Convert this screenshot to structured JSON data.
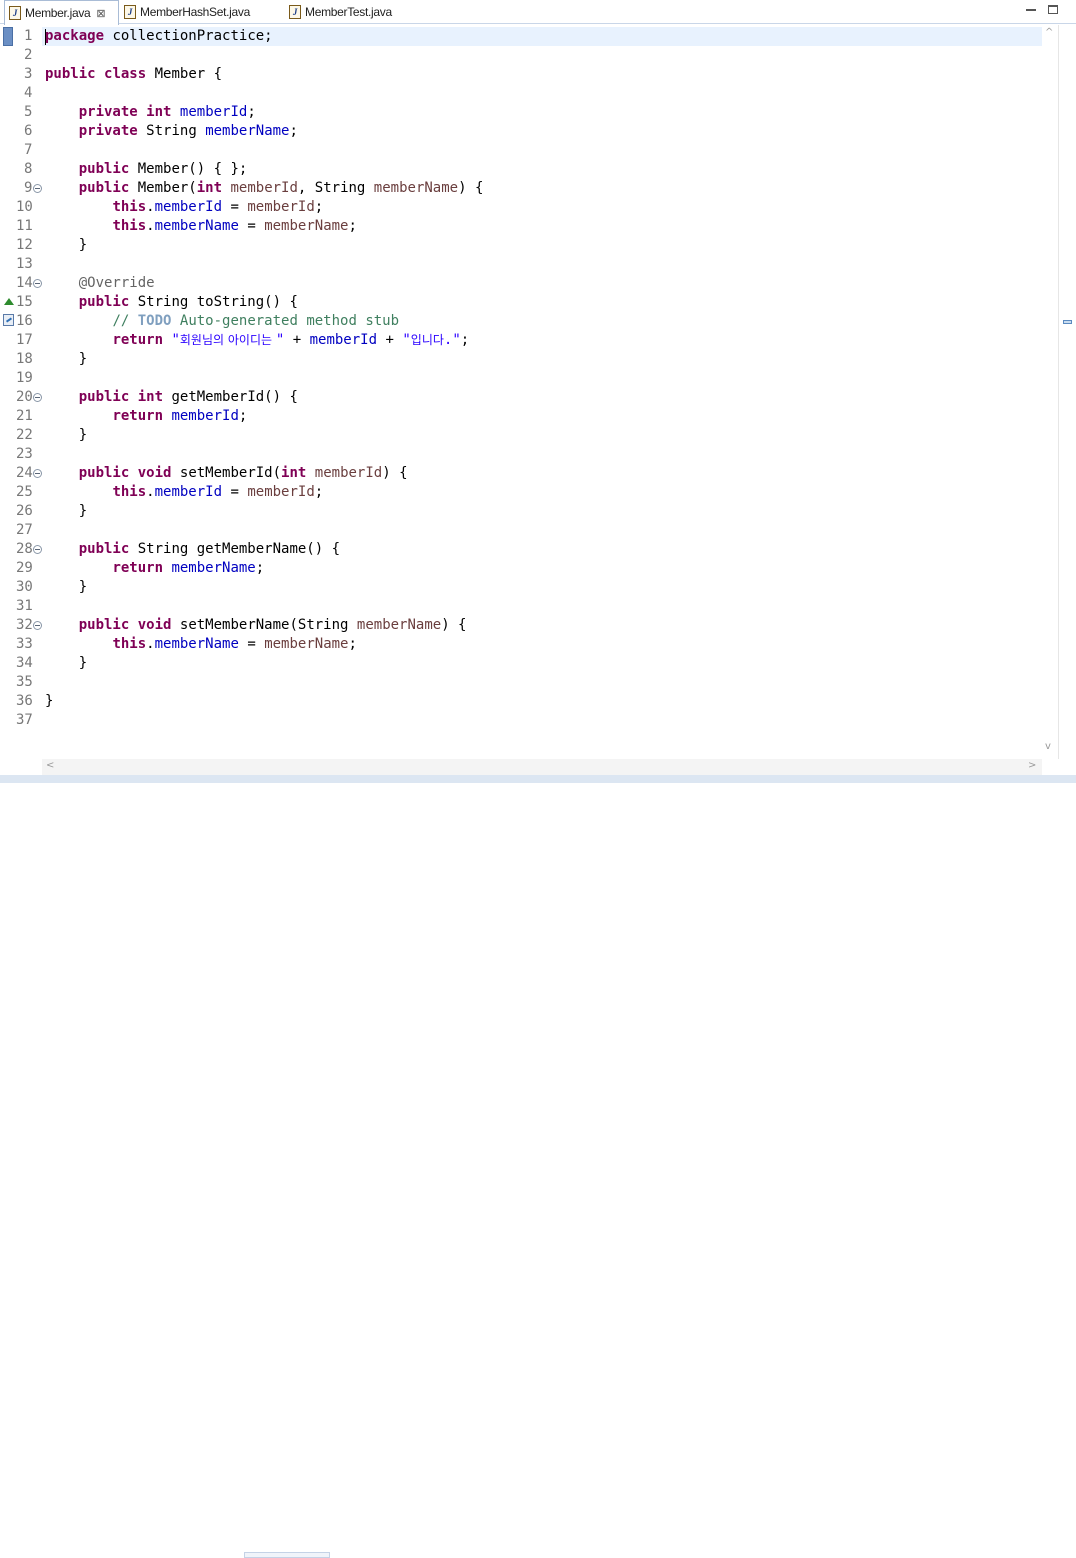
{
  "tabs": [
    {
      "label": "Member.java",
      "active": true,
      "closable": true,
      "icon": "java-file-icon"
    },
    {
      "label": "MemberHashSet.java",
      "active": false,
      "closable": false,
      "icon": "java-file-icon"
    },
    {
      "label": "MemberTest.java",
      "active": false,
      "closable": false,
      "icon": "java-file-icon"
    }
  ],
  "window_controls": {
    "minimize_icon": "minimize-icon",
    "maximize_icon": "maximize-icon",
    "close_glyph": "⊠"
  },
  "current_line": 1,
  "line_count": 37,
  "fold_lines": [
    9,
    14,
    20,
    24,
    28,
    32
  ],
  "gutter_markers": [
    {
      "line": 15,
      "icon": "override-triangle-icon"
    },
    {
      "line": 16,
      "icon": "task-marker-icon"
    }
  ],
  "code_lines": [
    [
      [
        "kw",
        "package"
      ],
      [
        "",
        "collectionPractice;"
      ]
    ],
    [],
    [
      [
        "kw",
        "public"
      ],
      [
        "",
        ""
      ],
      [
        "kw",
        "class"
      ],
      [
        "",
        "Member {"
      ]
    ],
    [],
    [
      [
        "",
        "    "
      ],
      [
        "kw",
        "private"
      ],
      [
        "",
        ""
      ],
      [
        "kw",
        "int"
      ],
      [
        "",
        ""
      ],
      [
        "fd",
        "memberId"
      ],
      [
        "",
        ";"
      ]
    ],
    [
      [
        "",
        "    "
      ],
      [
        "kw",
        "private"
      ],
      [
        "",
        "String"
      ],
      [
        "fd",
        "memberName"
      ],
      [
        "",
        ";"
      ]
    ],
    [],
    [
      [
        "",
        "    "
      ],
      [
        "kw",
        "public"
      ],
      [
        "",
        "Member() { };"
      ]
    ],
    [
      [
        "",
        "    "
      ],
      [
        "kw",
        "public"
      ],
      [
        "",
        "Member("
      ],
      [
        "kw",
        "int"
      ],
      [
        "",
        ""
      ],
      [
        "pm",
        "memberId"
      ],
      [
        "",
        ", String"
      ],
      [
        "pm",
        "memberName"
      ],
      [
        "",
        ") {"
      ]
    ],
    [
      [
        "",
        "        "
      ],
      [
        "kw",
        "this"
      ],
      [
        "",
        "."
      ],
      [
        "fd",
        "memberId"
      ],
      [
        "",
        "="
      ],
      [
        "pm",
        "memberId"
      ],
      [
        "",
        ";"
      ]
    ],
    [
      [
        "",
        "        "
      ],
      [
        "kw",
        "this"
      ],
      [
        "",
        "."
      ],
      [
        "fd",
        "memberName"
      ],
      [
        "",
        "="
      ],
      [
        "pm",
        "memberName"
      ],
      [
        "",
        ";"
      ]
    ],
    [
      [
        "",
        "    }"
      ]
    ],
    [],
    [
      [
        "",
        "    "
      ],
      [
        "an",
        "@Override"
      ]
    ],
    [
      [
        "",
        "    "
      ],
      [
        "kw",
        "public"
      ],
      [
        "",
        "String toString() {"
      ]
    ],
    [
      [
        "",
        "        "
      ],
      [
        "cm",
        "//"
      ],
      [
        "td",
        "TODO"
      ],
      [
        "cm",
        "Auto-generated method stub"
      ]
    ],
    [
      [
        "",
        "        "
      ],
      [
        "kw",
        "return"
      ],
      [
        "",
        ""
      ],
      [
        "st",
        "\""
      ],
      [
        "st ko",
        "회원님의 아이디는 "
      ],
      [
        "st",
        "\""
      ],
      [
        "",
        "+"
      ],
      [
        "fd",
        "memberId"
      ],
      [
        "",
        "+"
      ],
      [
        "st",
        "\""
      ],
      [
        "st ko",
        "입니다"
      ],
      [
        "st",
        ".\""
      ],
      [
        "",
        ";"
      ]
    ],
    [
      [
        "",
        "    }"
      ]
    ],
    [],
    [
      [
        "",
        "    "
      ],
      [
        "kw",
        "public"
      ],
      [
        "",
        ""
      ],
      [
        "kw",
        "int"
      ],
      [
        "",
        "getMemberId() {"
      ]
    ],
    [
      [
        "",
        "        "
      ],
      [
        "kw",
        "return"
      ],
      [
        "",
        ""
      ],
      [
        "fd",
        "memberId"
      ],
      [
        "",
        ";"
      ]
    ],
    [
      [
        "",
        "    }"
      ]
    ],
    [],
    [
      [
        "",
        "    "
      ],
      [
        "kw",
        "public"
      ],
      [
        "",
        ""
      ],
      [
        "kw",
        "void"
      ],
      [
        "",
        "setMemberId("
      ],
      [
        "kw",
        "int"
      ],
      [
        "",
        ""
      ],
      [
        "pm",
        "memberId"
      ],
      [
        "",
        ") {"
      ]
    ],
    [
      [
        "",
        "        "
      ],
      [
        "kw",
        "this"
      ],
      [
        "",
        "."
      ],
      [
        "fd",
        "memberId"
      ],
      [
        "",
        "="
      ],
      [
        "pm",
        "memberId"
      ],
      [
        "",
        ";"
      ]
    ],
    [
      [
        "",
        "    }"
      ]
    ],
    [],
    [
      [
        "",
        "    "
      ],
      [
        "kw",
        "public"
      ],
      [
        "",
        "String getMemberName() {"
      ]
    ],
    [
      [
        "",
        "        "
      ],
      [
        "kw",
        "return"
      ],
      [
        "",
        ""
      ],
      [
        "fd",
        "memberName"
      ],
      [
        "",
        ";"
      ]
    ],
    [
      [
        "",
        "    }"
      ]
    ],
    [],
    [
      [
        "",
        "    "
      ],
      [
        "kw",
        "public"
      ],
      [
        "",
        ""
      ],
      [
        "kw",
        "void"
      ],
      [
        "",
        "setMemberName(String"
      ],
      [
        "pm",
        "memberName"
      ],
      [
        "",
        ") {"
      ]
    ],
    [
      [
        "",
        "        "
      ],
      [
        "kw",
        "this"
      ],
      [
        "",
        "."
      ],
      [
        "fd",
        "memberName"
      ],
      [
        "",
        "="
      ],
      [
        "pm",
        "memberName"
      ],
      [
        "",
        ";"
      ]
    ],
    [
      [
        "",
        "    }"
      ]
    ],
    [],
    [
      [
        "",
        "}"
      ]
    ],
    []
  ],
  "scroll_arrows": {
    "up": "^",
    "down": "v",
    "left": "<",
    "right": ">"
  }
}
